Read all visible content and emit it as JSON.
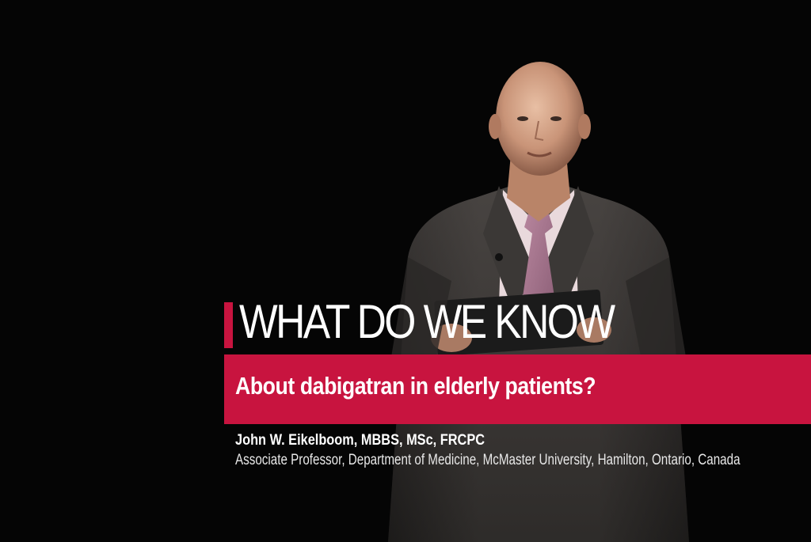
{
  "headline": "WHAT DO WE KNOW",
  "subtitle": "About dabigatran in elderly patients?",
  "speaker": {
    "name": "John W. Eikelboom, MBBS, MSc, FRCPC",
    "title": "Associate Professor, Department of Medicine, McMaster University, Hamilton, Ontario, Canada"
  },
  "colors": {
    "accent": "#c8143f",
    "background": "#050505",
    "text": "#ffffff"
  }
}
